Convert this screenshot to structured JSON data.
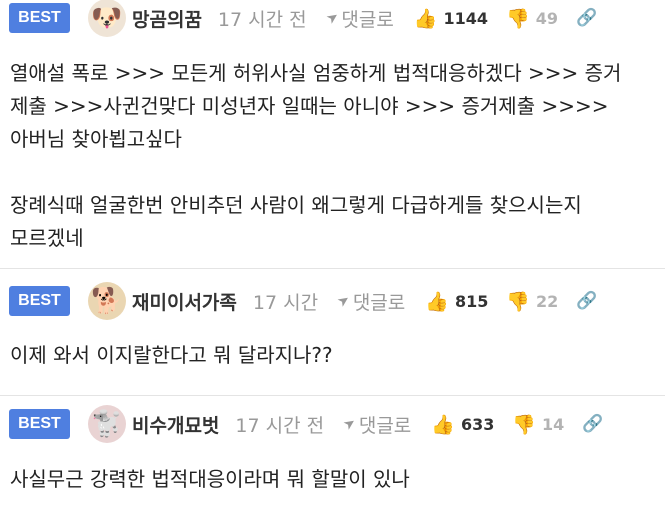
{
  "best_label": "BEST",
  "reply_label": "댓글로",
  "comments": [
    {
      "nickname": "망곰의꿈",
      "time": "17 시간 전",
      "upvotes": "1144",
      "downvotes": "49",
      "avatar_icon": "puppy-icon",
      "body": "열애설 폭로 >>> 모든게 허위사실 엄중하게 법적대응하겠다 >>> 증거 제출 >>>사귄건맞다 미성년자 일때는 아니야 >>> 증거제출 >>>> 아버님 찾아뵙고싶다\n\n장례식때 얼굴한번 안비추던 사람이 왜그렇게 다급하게들 찾으시는지 모르겠네"
    },
    {
      "nickname": "재미이서가족",
      "time": "17 시간",
      "upvotes": "815",
      "downvotes": "22",
      "avatar_icon": "chihuahua-icon",
      "body": "이제 와서 이지랄한다고 뭐 달라지나??"
    },
    {
      "nickname": "비수개묘벗",
      "time": "17 시간 전",
      "upvotes": "633",
      "downvotes": "14",
      "avatar_icon": "dog-icon",
      "body": "사실무근 강력한 법적대응이라며 뭐 할말이 있나"
    }
  ],
  "colors": {
    "best_badge": "#4f7fe0",
    "meta_gray": "#999999",
    "divider": "#e4e4e4"
  }
}
